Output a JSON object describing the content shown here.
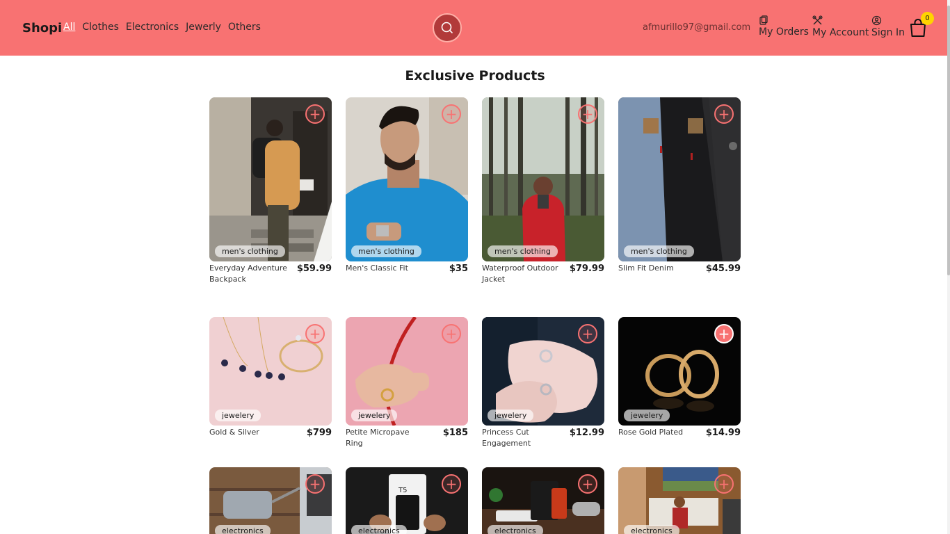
{
  "navbar": {
    "brand": "Shopi",
    "links": [
      "All",
      "Clothes",
      "Electronics",
      "Jewerly",
      "Others"
    ],
    "email": "afmurillo97@gmail.com",
    "my_orders": "My Orders",
    "my_account": "My Account",
    "sign_in": "Sign In",
    "cart_count": "0"
  },
  "main": {
    "title": "Exclusive Products",
    "add_symbol": "+",
    "products": [
      {
        "name": "Everyday Adventure Backpack",
        "price": "$59.99",
        "category": "men's clothing"
      },
      {
        "name": "Men's Classic Fit",
        "price": "$35",
        "category": "men's clothing"
      },
      {
        "name": "Waterproof Outdoor Jacket",
        "price": "$79.99",
        "category": "men's clothing"
      },
      {
        "name": "Slim Fit Denim",
        "price": "$45.99",
        "category": "men's clothing"
      },
      {
        "name": "Gold & Silver",
        "price": "$799",
        "category": "jewelery"
      },
      {
        "name": "Petite Micropave Ring",
        "price": "$185",
        "category": "jewelery"
      },
      {
        "name": "Princess Cut Engagement",
        "price": "$12.99",
        "category": "jewelery"
      },
      {
        "name": "Rose Gold Plated",
        "price": "$14.99",
        "category": "jewelery"
      },
      {
        "name": "",
        "price": "",
        "category": "electronics"
      },
      {
        "name": "",
        "price": "",
        "category": "electronics"
      },
      {
        "name": "",
        "price": "",
        "category": "electronics"
      },
      {
        "name": "",
        "price": "",
        "category": "electronics"
      }
    ]
  },
  "colors": {
    "accent": "#f87272",
    "badge": "#ffd400"
  }
}
